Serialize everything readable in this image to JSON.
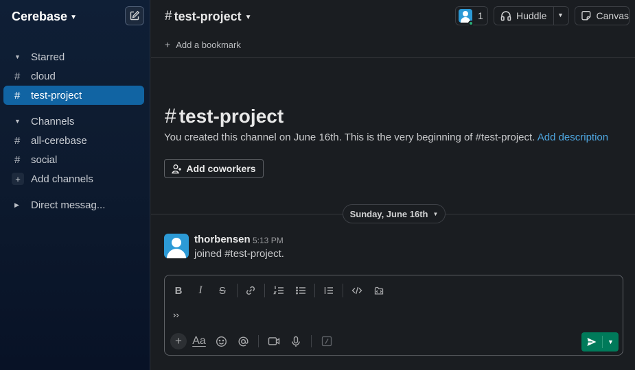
{
  "workspace": {
    "name": "Cerebase"
  },
  "sidebar": {
    "sections": [
      {
        "label": "Starred",
        "items": [
          {
            "label": "cloud"
          },
          {
            "label": "test-project",
            "active": true
          }
        ]
      },
      {
        "label": "Channels",
        "items": [
          {
            "label": "all-cerebase"
          },
          {
            "label": "social"
          }
        ],
        "add_label": "Add channels"
      },
      {
        "label": "Direct messag..."
      }
    ]
  },
  "header": {
    "channel": "test-project",
    "member_count": "1",
    "huddle_label": "Huddle",
    "canvas_label": "Canvas",
    "bookmark_label": "Add a bookmark"
  },
  "intro": {
    "title": "test-project",
    "text_prefix": "You created this channel on June 16th. This is the very beginning of",
    "channel_ref": "test-project.",
    "add_description": "Add description",
    "add_coworkers": "Add coworkers"
  },
  "date_divider": "Sunday, June 16th",
  "message": {
    "author": "thorbensen",
    "time": "5:13 PM",
    "text": "joined #test-project."
  },
  "composer": {
    "text": "››"
  },
  "colors": {
    "accent_active": "#1164a3",
    "link": "#4ea6e0",
    "send": "#007a5a",
    "online": "#2bac76"
  }
}
